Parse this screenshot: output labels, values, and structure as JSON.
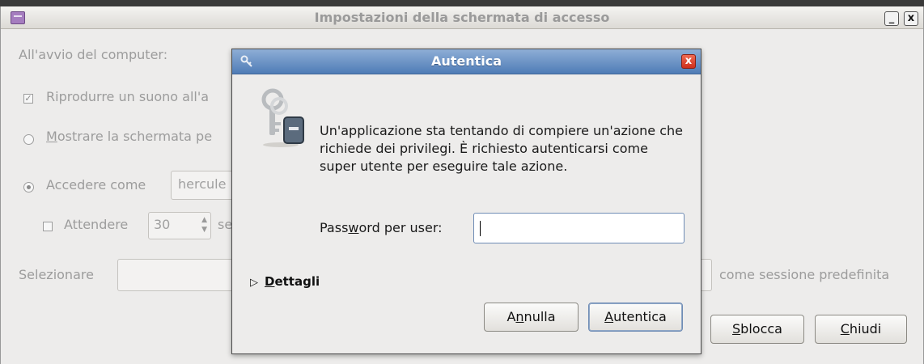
{
  "parent_window": {
    "title": "Impostazioni della schermata di accesso",
    "minimize_label": "_",
    "close_label": "x",
    "startup_label": "All'avvio del computer:",
    "play_sound_label": "Riprodurre un suono all'a",
    "play_sound_checked": true,
    "show_screen_label": "Mostrare la schermata pe",
    "login_as_label": "Accedere come",
    "login_user_value": "hercule",
    "wait_label": "Attendere",
    "wait_value": "30",
    "wait_suffix": "se",
    "select_label": "Selezionare",
    "session_suffix": "come sessione predefinita",
    "unlock_button": "Sblocca",
    "close_button": "Chiudi"
  },
  "dialog": {
    "title": "Autentica",
    "close_label": "x",
    "message": "Un'applicazione sta tentando di compiere un'azione che richiede dei privilegi. È richiesto autenticarsi come super utente per eseguire tale azione.",
    "password_label": "Password per user:",
    "password_value": "",
    "details_label": "Dettagli",
    "cancel_button": "Annulla",
    "authenticate_button": "Autentica"
  }
}
